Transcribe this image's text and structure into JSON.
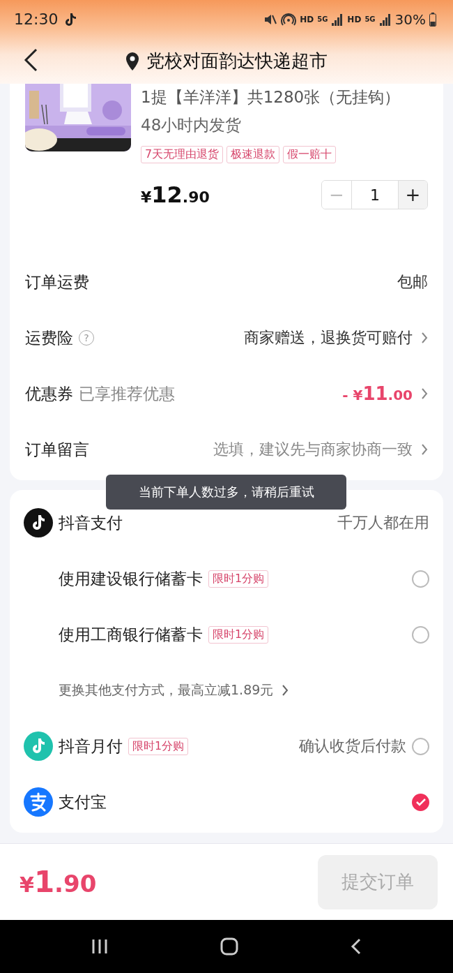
{
  "status_bar": {
    "time": "12:30",
    "networks": [
      {
        "hd": "HD",
        "gen": "5G"
      },
      {
        "hd": "HD",
        "gen": "5G"
      }
    ],
    "battery": "30%"
  },
  "header": {
    "title": "党校对面韵达快递超市"
  },
  "product": {
    "title": "1提【羊洋洋】共1280张（无挂钩）",
    "shipping": "48小时内发货",
    "tags": [
      "7天无理由退货",
      "极速退款",
      "假一赔十"
    ],
    "price": "¥12.90",
    "quantity": {
      "decrease": "−",
      "value": "1",
      "increase": "+",
      "decrease_disabled": true
    }
  },
  "order_rows": [
    {
      "kind": "plain",
      "label": "订单运费",
      "value": "包邮",
      "chevron": false
    },
    {
      "kind": "help",
      "label": "运费险",
      "help_mark": "?",
      "value": "商家赠送，退换货可赔付",
      "chevron": true
    },
    {
      "kind": "discount",
      "label": "优惠券",
      "sublabel": "已享推荐优惠",
      "value": "- ¥11.00",
      "chevron": true
    },
    {
      "kind": "hint",
      "label": "订单留言",
      "value": "选填，建议先与商家协商一致",
      "chevron": true
    }
  ],
  "payment": [
    {
      "kind": "provider",
      "name": "抖音支付",
      "note": "千万人都在用"
    },
    {
      "kind": "card",
      "name": "使用建设银行储蓄卡",
      "tag": "限时1分购",
      "selected": false
    },
    {
      "kind": "card",
      "name": "使用工商银行储蓄卡",
      "tag": "限时1分购",
      "selected": false
    },
    {
      "kind": "more",
      "text": "更换其他支付方式，最高立减1.89元"
    },
    {
      "kind": "monthly",
      "name": "抖音月付",
      "tag": "限时1分购",
      "note": "确认收货后付款",
      "selected": false
    },
    {
      "kind": "wallet",
      "name": "支付宝",
      "selected": true
    }
  ],
  "toast": {
    "text": "当前下单人数过多，请稍后重试"
  },
  "footer": {
    "total": "¥1.90",
    "submit": "提交订单",
    "submit_disabled": true
  }
}
